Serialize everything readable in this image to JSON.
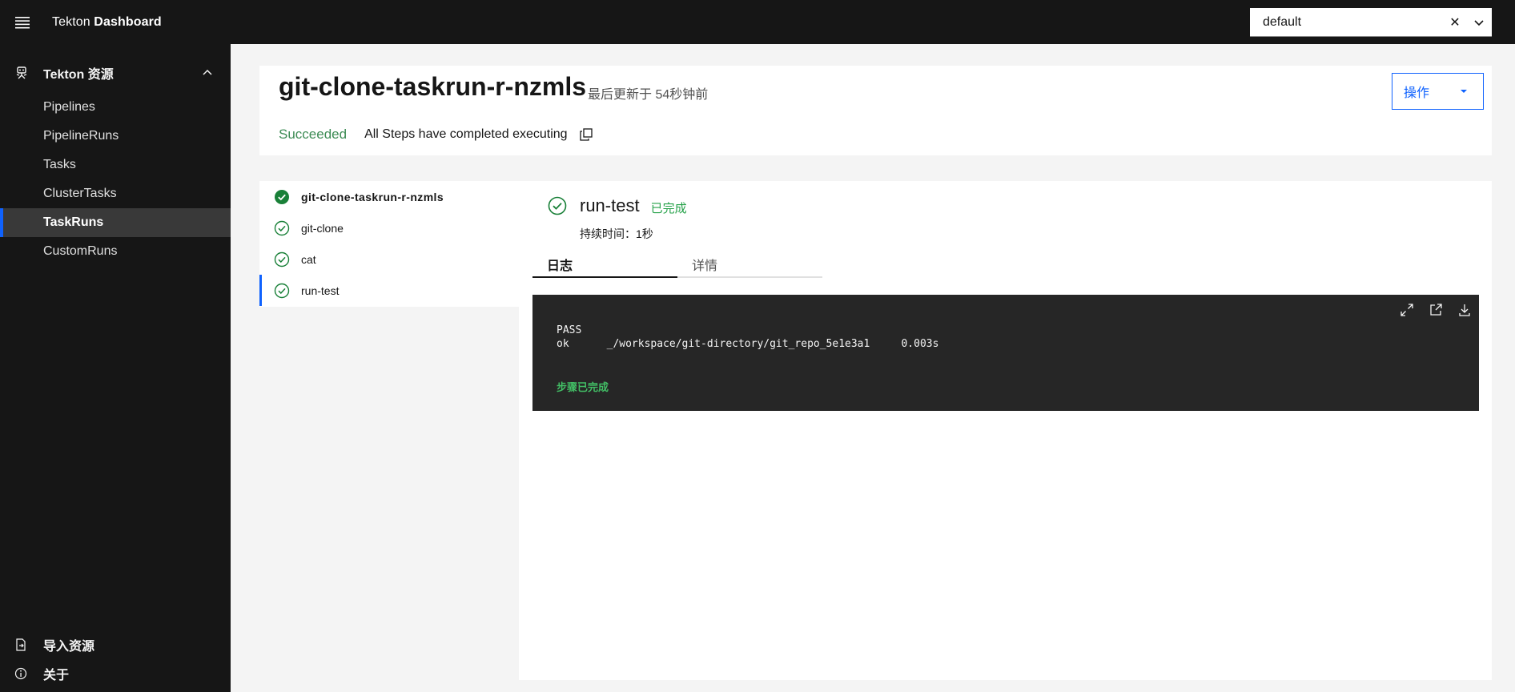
{
  "header": {
    "brand_prefix": "Tekton",
    "brand_name": "Dashboard",
    "namespace": "default",
    "clear_glyph": "✕"
  },
  "sidebar": {
    "group_label": "Tekton 资源",
    "items": [
      {
        "label": "Pipelines"
      },
      {
        "label": "PipelineRuns"
      },
      {
        "label": "Tasks"
      },
      {
        "label": "ClusterTasks"
      },
      {
        "label": "TaskRuns",
        "active": true
      },
      {
        "label": "CustomRuns"
      }
    ],
    "bottom": [
      {
        "label": "导入资源",
        "icon": "import-icon"
      },
      {
        "label": "关于",
        "icon": "info-icon"
      }
    ]
  },
  "run": {
    "title": "git-clone-taskrun-r-nzmls",
    "updated": "最后更新于 54秒钟前",
    "actions_label": "操作",
    "status": "Succeeded",
    "status_message": "All Steps have completed executing"
  },
  "steps": [
    {
      "label": "git-clone-taskrun-r-nzmls",
      "header": true
    },
    {
      "label": "git-clone"
    },
    {
      "label": "cat"
    },
    {
      "label": "run-test",
      "selected": true
    }
  ],
  "detail": {
    "step_name": "run-test",
    "step_status": "已完成",
    "duration": "持续时间：1秒",
    "tabs": [
      {
        "label": "日志",
        "active": true
      },
      {
        "label": "详情"
      }
    ],
    "log_lines": [
      "PASS",
      "ok      _/workspace/git-directory/git_repo_5e1e3a1     0.003s"
    ],
    "log_complete": "步骤已完成"
  },
  "colors": {
    "accent": "#0f62fe",
    "success": "#24a148",
    "sidebar_bg": "#161616",
    "log_bg": "#262626"
  }
}
